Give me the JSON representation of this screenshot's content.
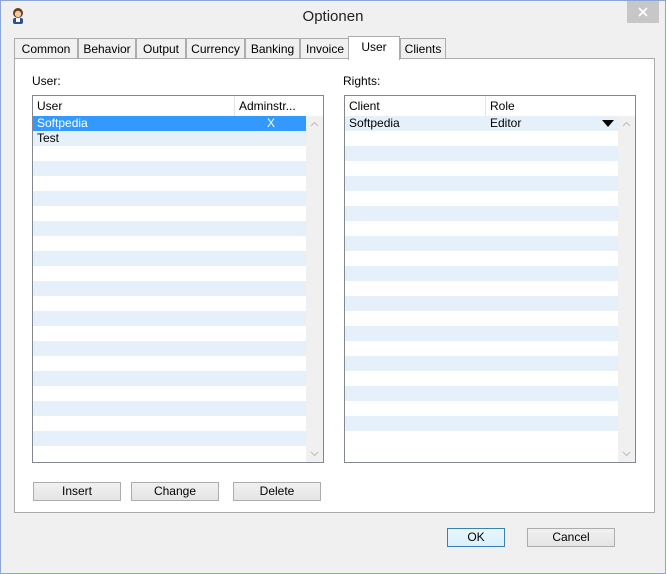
{
  "window": {
    "title": "Optionen"
  },
  "tabs": [
    {
      "label": "Common"
    },
    {
      "label": "Behavior"
    },
    {
      "label": "Output"
    },
    {
      "label": "Currency"
    },
    {
      "label": "Banking"
    },
    {
      "label": "Invoice"
    },
    {
      "label": "User"
    },
    {
      "label": "Clients"
    }
  ],
  "active_tab": "User",
  "users": {
    "label": "User:",
    "columns": [
      "User",
      "Adminstr..."
    ],
    "rows": [
      {
        "user": "Softpedia",
        "admin": "X",
        "selected": true
      },
      {
        "user": "Test",
        "admin": ""
      }
    ]
  },
  "rights": {
    "label": "Rights:",
    "columns": [
      "Client",
      "Role"
    ],
    "rows": [
      {
        "client": "Softpedia",
        "role": "Editor"
      }
    ]
  },
  "buttons": {
    "insert": "Insert",
    "change": "Change",
    "delete": "Delete",
    "ok": "OK",
    "cancel": "Cancel"
  },
  "colors": {
    "selection": "#3399ff",
    "alt_row": "#e6f0fb"
  }
}
